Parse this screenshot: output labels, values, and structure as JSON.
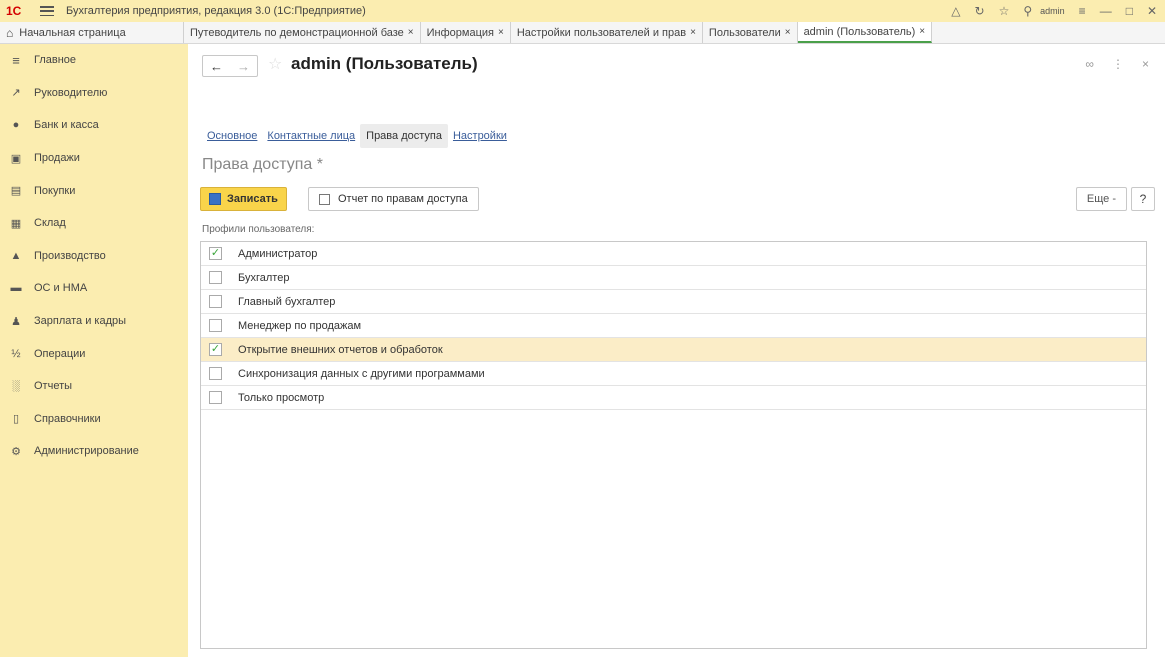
{
  "titlebar": {
    "logo": "1С",
    "title": "Бухгалтерия предприятия, редакция 3.0 (1С:Предприятие)",
    "user": "admin"
  },
  "tabs": [
    {
      "label": "Начальная страница"
    },
    {
      "label": "Путеводитель по демонстрационной базе",
      "close": "×"
    },
    {
      "label": "Информация",
      "close": "×"
    },
    {
      "label": "Настройки пользователей и прав",
      "close": "×"
    },
    {
      "label": "Пользователи",
      "close": "×"
    },
    {
      "label": "admin (Пользователь)",
      "close": "×"
    }
  ],
  "sidebar": {
    "items": [
      {
        "label": "Главное",
        "icon": "menu-icon"
      },
      {
        "label": "Руководителю",
        "icon": "trend-icon"
      },
      {
        "label": "Банк и касса",
        "icon": "coin-icon"
      },
      {
        "label": "Продажи",
        "icon": "bag-icon"
      },
      {
        "label": "Покупки",
        "icon": "cart-icon"
      },
      {
        "label": "Склад",
        "icon": "warehouse-icon"
      },
      {
        "label": "Производство",
        "icon": "factory-icon"
      },
      {
        "label": "ОС и НМА",
        "icon": "truck-icon"
      },
      {
        "label": "Зарплата и кадры",
        "icon": "person-icon"
      },
      {
        "label": "Операции",
        "icon": "operations-icon"
      },
      {
        "label": "Отчеты",
        "icon": "report-icon"
      },
      {
        "label": "Справочники",
        "icon": "book-icon"
      },
      {
        "label": "Администрирование",
        "icon": "gear-icon"
      }
    ]
  },
  "form": {
    "title": "admin (Пользователь)",
    "subtabs": [
      {
        "label": "Основное"
      },
      {
        "label": "Контактные лица"
      },
      {
        "label": "Права доступа"
      },
      {
        "label": "Настройки"
      }
    ],
    "section_title": "Права доступа *",
    "save_label": "Записать",
    "report_label": "Отчет по правам доступа",
    "more_label": "Еще -",
    "help_label": "?",
    "profiles_label": "Профили пользователя:",
    "profiles": [
      {
        "label": "Администратор",
        "checked": true
      },
      {
        "label": "Бухгалтер",
        "checked": false
      },
      {
        "label": "Главный бухгалтер",
        "checked": false
      },
      {
        "label": "Менеджер по продажам",
        "checked": false
      },
      {
        "label": "Открытие внешних отчетов и обработок",
        "checked": true
      },
      {
        "label": "Синхронизация данных с другими программами",
        "checked": false
      },
      {
        "label": "Только просмотр",
        "checked": false
      }
    ]
  }
}
